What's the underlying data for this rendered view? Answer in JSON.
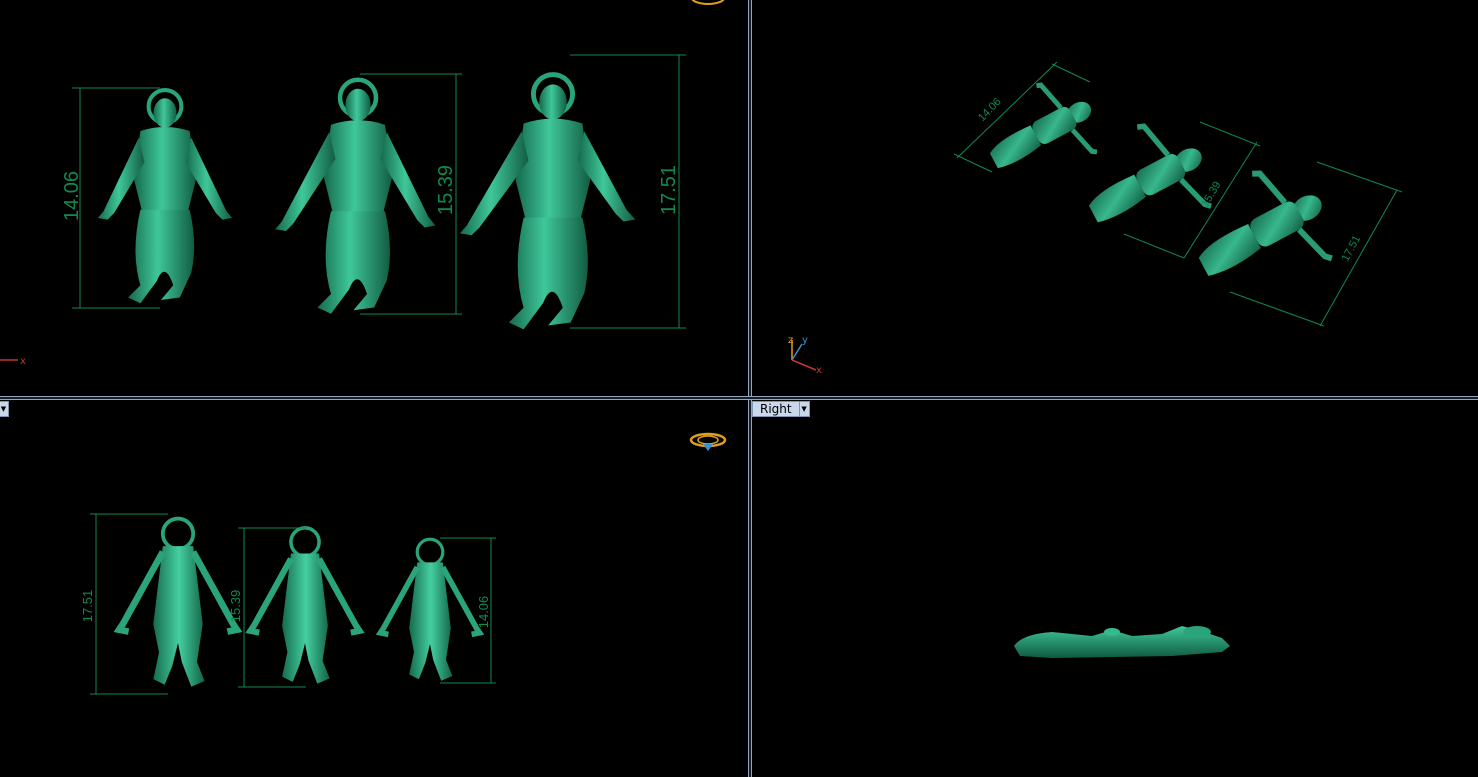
{
  "viewports": {
    "top_left": {
      "dims": [
        "14.06",
        "15.39",
        "17.51"
      ],
      "axis_label": "x"
    },
    "top_right": {
      "dims": [
        "14.06",
        "15.39",
        "17.51"
      ],
      "axis_labels": [
        "z",
        "y",
        "x"
      ]
    },
    "bottom_left": {
      "dims": [
        "17.51",
        "15.39",
        "14.06"
      ]
    },
    "bottom_right": {
      "title": "Right"
    }
  },
  "colors": {
    "model": "#1f8f6a",
    "model_highlight": "#3fc79a",
    "dimension": "#0f8a4f",
    "divider": "#8fa6c2",
    "gumball_gold": "#e0a020"
  },
  "icons": {
    "gumball": "gumball-icon",
    "axis": "axis-icon"
  }
}
